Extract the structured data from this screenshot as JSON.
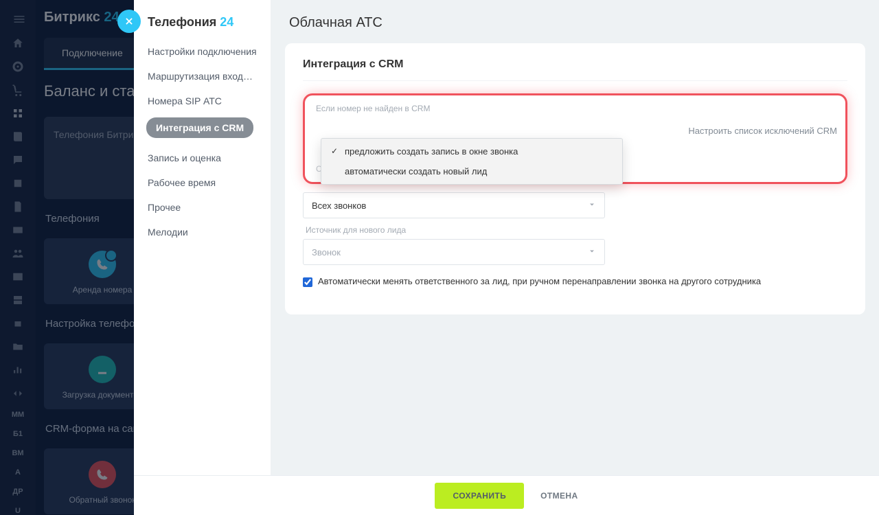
{
  "brand": {
    "name": "Битрикс",
    "accent": "24"
  },
  "tabs": {
    "connection": "Подключение"
  },
  "balance_title": "Баланс и стат",
  "cards": {
    "telephony": "Телефония Битрик"
  },
  "sections": {
    "telephony": "Телефония",
    "rent_number": "Аренда номера",
    "settings": "Настройка телефони",
    "upload_docs": "Загрузка документов",
    "crm_form": "CRM-форма на сайт",
    "callback": "Обратный звонок"
  },
  "panel": {
    "title": "Телефония",
    "title_accent": "24",
    "nav": {
      "connection_settings": "Настройки подключения",
      "routing": "Маршрутизация входящ…",
      "sip_numbers": "Номера SIP АТС",
      "crm_integration": "Интеграция с CRM",
      "recording": "Запись и оценка",
      "working_hours": "Рабочее время",
      "other": "Прочее",
      "melodies": "Мелодии"
    }
  },
  "main": {
    "title": "Облачная АТС",
    "section_heading": "Интеграция с CRM",
    "highlight": {
      "label": "Если номер не найден в CRM",
      "options": {
        "suggest": "предложить создать запись в окне звонка",
        "auto_lead": "автоматически создать новый лид"
      },
      "under_label": "Создавать лид для",
      "config_link": "Настроить список исключений CRM"
    },
    "lead_for": {
      "value": "Всех звонков"
    },
    "source": {
      "label": "Источник для нового лида",
      "value": "Звонок"
    },
    "checkbox_label": "Автоматически менять ответственного за лид, при ручном перенаправлении звонка на другого сотрудника"
  },
  "footer": {
    "save": "Сохранить",
    "cancel": "Отмена"
  },
  "sidebar_txt": {
    "mm": "ММ",
    "b1": "Б1",
    "bm": "ВМ",
    "a": "А",
    "dr": "ДР",
    "u": "U"
  }
}
